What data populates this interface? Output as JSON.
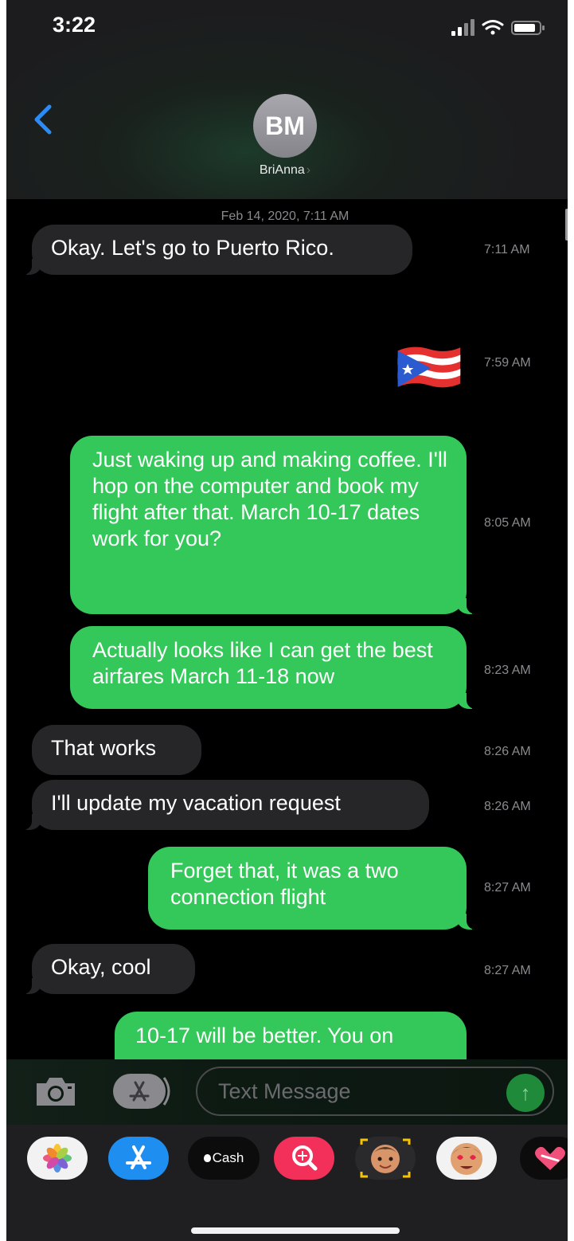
{
  "status_bar": {
    "time": "3:22"
  },
  "contact": {
    "initials": "BM",
    "name": "BriAnna",
    "chevron": "›"
  },
  "conversation": {
    "date_header": "Feb 14, 2020, 7:11 AM",
    "messages": [
      {
        "direction": "received",
        "text": "Okay. Let's go to Puerto Rico.",
        "time": "7:11 AM"
      },
      {
        "direction": "sent",
        "text": "🇵🇷",
        "emoji": "puerto-rico-flag",
        "time": "7:59 AM"
      },
      {
        "direction": "sent",
        "text": "Just waking up and making coffee. I'll hop on the computer and book my flight after that. March 10-17 dates work for you?",
        "time": "8:05 AM"
      },
      {
        "direction": "sent",
        "text": "Actually looks like I can get the best airfares March 11-18 now",
        "time": "8:23 AM"
      },
      {
        "direction": "received",
        "text": "That works",
        "time": "8:26 AM"
      },
      {
        "direction": "received",
        "text": "I'll update my vacation request",
        "time": "8:26 AM"
      },
      {
        "direction": "sent",
        "text": "Forget that, it was a two connection flight",
        "time": "8:27 AM"
      },
      {
        "direction": "received",
        "text": "Okay, cool",
        "time": "8:27 AM"
      },
      {
        "direction": "sent",
        "text": "10-17 will be better. You on",
        "time": ""
      }
    ]
  },
  "compose": {
    "placeholder": "Text Message",
    "camera_icon": "camera-icon",
    "apps_icon": "app-store-icon",
    "send_icon": "arrow-up-icon"
  },
  "app_drawer": {
    "apps": [
      "photos",
      "app-store",
      "apple-cash",
      "web-images-search",
      "memoji",
      "animoji-stickers",
      "digital-touch"
    ],
    "cash_label": "Cash"
  },
  "colors": {
    "sent_bubble": "#34c759",
    "received_bubble": "#262628",
    "back_chevron": "#2c8cf6",
    "timestamp": "#8a8a8e"
  }
}
